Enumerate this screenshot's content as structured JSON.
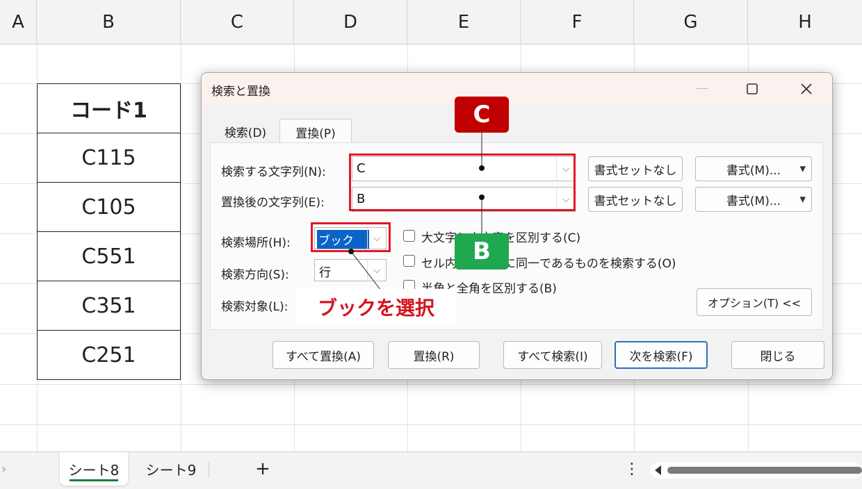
{
  "spreadsheet": {
    "columns": [
      "A",
      "B",
      "C",
      "D",
      "E",
      "F",
      "G",
      "H"
    ],
    "table": {
      "header": "コード1",
      "rows": [
        "C115",
        "C105",
        "C551",
        "C351",
        "C251"
      ]
    }
  },
  "dialog": {
    "title": "検索と置換",
    "tabs": [
      "検索(D)",
      "置換(P)"
    ],
    "find_label": "検索する文字列(N):",
    "find_value": "C",
    "replace_label": "置換後の文字列(E):",
    "replace_value": "B",
    "no_format_label": "書式セットなし",
    "format_label": "書式(M)...",
    "within_label": "検索場所(H):",
    "within_value": "ブック",
    "search_label": "検索方向(S):",
    "search_value": "行",
    "lookin_label": "検索対象(L):",
    "option_case": "大文字と小文字を区別する(C)",
    "option_entire": "セル内容が完全に同一であるものを検索する(O)",
    "option_width": "半角と全角を区別する(B)",
    "options_button": "オプション(T) <<",
    "buttons": {
      "replace_all": "すべて置換(A)",
      "replace": "置換(R)",
      "find_all": "すべて検索(I)",
      "find_next": "次を検索(F)",
      "close": "閉じる"
    }
  },
  "annotations": {
    "badge_c": "C",
    "badge_b": "B",
    "callout": "ブックを選択",
    "badge_c_color": "#c00000",
    "badge_b_color": "#1fa84f"
  },
  "sheets": {
    "tabs": [
      "シート8",
      "シート9"
    ],
    "add": "+",
    "more": "⋮"
  }
}
